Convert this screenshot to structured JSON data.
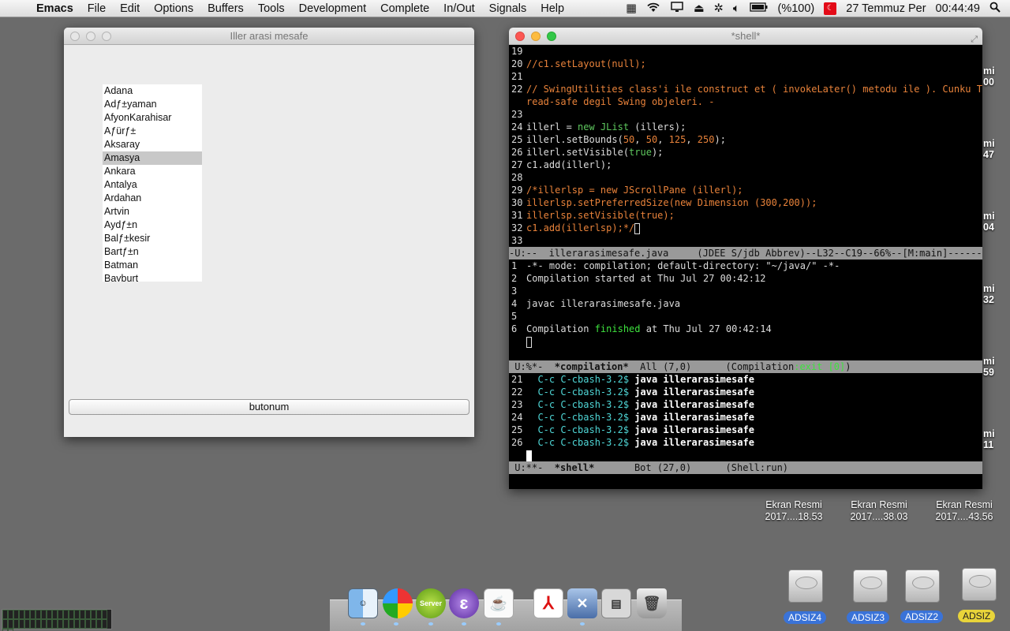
{
  "menubar": {
    "app": "Emacs",
    "items": [
      "File",
      "Edit",
      "Options",
      "Buffers",
      "Tools",
      "Development",
      "Complete",
      "In/Out",
      "Signals",
      "Help"
    ],
    "battery": "(%100)",
    "flag": "TR",
    "date": "27 Temmuz Per",
    "time": "00:44:49"
  },
  "java_window": {
    "title": "Iller arasi mesafe",
    "list_items": [
      "Adana",
      "Adƒ±yaman",
      "AfyonKarahisar",
      "Aƒürƒ±",
      "Aksaray",
      "Amasya",
      "Ankara",
      "Antalya",
      "Ardahan",
      "Artvin",
      "Aydƒ±n",
      "Balƒ±kesir",
      "Bartƒ±n",
      "Batman",
      "Bayburt"
    ],
    "selected": "Amasya",
    "button_label": "butonum"
  },
  "emacs": {
    "title": "*shell*",
    "code_lines": [
      {
        "n": "19",
        "t": ""
      },
      {
        "n": "20",
        "t": "//c1.setLayout(null);",
        "cls": "cm"
      },
      {
        "n": "21",
        "t": ""
      },
      {
        "n": "22",
        "t": "// SwingUtilities class'i ile construct et ( invokeLater() metodu ile ). Cunku Th",
        "cls": "cm"
      },
      {
        "n": "",
        "t": "read-safe degil Swing objeleri. -",
        "cls": "cm"
      },
      {
        "n": "23",
        "t": ""
      },
      {
        "n": "24",
        "html": "illerl = <span class=\"kw\">new</span> <span class=\"kw\">JList</span> (illers);"
      },
      {
        "n": "25",
        "html": "illerl.setBounds(<span class=\"num\">50</span>, <span class=\"num\">50</span>, <span class=\"num\">125</span>, <span class=\"num\">250</span>);"
      },
      {
        "n": "26",
        "html": "illerl.setVisible(<span class=\"kw\">true</span>);"
      },
      {
        "n": "27",
        "t": "c1.add(illerl);"
      },
      {
        "n": "28",
        "t": ""
      },
      {
        "n": "29",
        "t": "/*illerlsp = new JScrollPane (illerl);",
        "cls": "cm"
      },
      {
        "n": "30",
        "t": "illerlsp.setPreferredSize(new Dimension (300,200));",
        "cls": "cm"
      },
      {
        "n": "31",
        "t": "illerlsp.setVisible(true);",
        "cls": "cm"
      },
      {
        "n": "32",
        "t": "c1.add(illerlsp);*/",
        "cls": "cm",
        "cursor": true
      },
      {
        "n": "33",
        "t": ""
      }
    ],
    "modeline1": "-U:--  illerarasimesafe.java     (JDEE S/jdb Abbrev)--L32--C19--66%--[M:main]-------",
    "comp_lines": [
      {
        "n": "1",
        "t": "-*- mode: compilation; default-directory: \"~/java/\" -*-"
      },
      {
        "n": "2",
        "t": "Compilation started at Thu Jul 27 00:42:12"
      },
      {
        "n": "3",
        "t": ""
      },
      {
        "n": "4",
        "t": "javac illerarasimesafe.java"
      },
      {
        "n": "5",
        "t": ""
      },
      {
        "n": "6",
        "html": "Compilation <span class=\"grnt\">finished</span> at Thu Jul 27 00:42:14"
      }
    ],
    "modeline2_a": " U:%*-  ",
    "modeline2_buf": "*compilation*",
    "modeline2_b": "  All (7,0)      (Compilation",
    "modeline2_exit": ":exit [0]",
    "modeline2_c": ")",
    "shell_prompt_cc": "C-c C-c",
    "shell_prompt": "bash-3.2$",
    "shell_cmd": "java illerarasimesafe",
    "shell_nums": [
      "21",
      "22",
      "23",
      "24",
      "25",
      "26"
    ],
    "modeline3_a": " U:**-  ",
    "modeline3_buf": "*shell*",
    "modeline3_b": "       Bot (27,0)      (Shell:run)"
  },
  "desktop": {
    "screenshots": [
      {
        "name": "Ekran Resmi",
        "date": "2017....18.53"
      },
      {
        "name": "Ekran Resmi",
        "date": "2017....38.03"
      },
      {
        "name": "Ekran Resmi",
        "date": "2017....43.56"
      }
    ],
    "partial_labels": [
      {
        "a": "mi",
        "b": "00"
      },
      {
        "a": "mi",
        "b": "47"
      },
      {
        "a": "mi",
        "b": "04"
      },
      {
        "a": "mi",
        "b": "32"
      },
      {
        "a": "mi",
        "b": "59"
      },
      {
        "a": "mi",
        "b": "11"
      }
    ],
    "drives": [
      "ADSIZ4",
      "ADSIZ3",
      "ADSIZ2",
      "ADSIZ"
    ]
  },
  "dock": {
    "items": [
      "finder-icon",
      "istat-pie-icon",
      "server-vnc-icon",
      "emacs-icon",
      "java-icon",
      "acrobat-icon",
      "xquartz-icon",
      "activity-monitor-icon",
      "trash-icon"
    ],
    "server_label": "Server"
  }
}
